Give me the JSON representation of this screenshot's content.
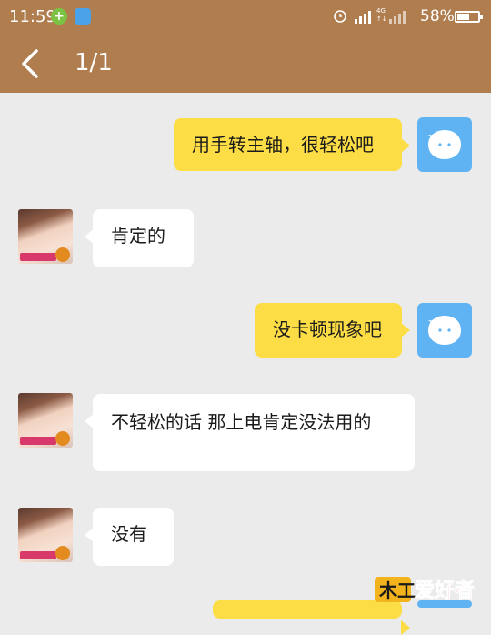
{
  "status_bar": {
    "time": "11:59",
    "network_type_top": "4G",
    "network_type_bottom": "2G",
    "battery_percent": "58%",
    "battery_level": 0.58
  },
  "header": {
    "page_counter": "1/1",
    "accent_color": "#b07d4f"
  },
  "messages": [
    {
      "sender": "me",
      "text": "用手转主轴，很轻松吧"
    },
    {
      "sender": "them",
      "text": "肯定的"
    },
    {
      "sender": "me",
      "text": "没卡顿现象吧"
    },
    {
      "sender": "them",
      "text": "不轻松的话 那上电肯定没法用的"
    },
    {
      "sender": "them",
      "text": "没有"
    }
  ],
  "watermark": {
    "logo_text": "爱好者"
  },
  "colors": {
    "my_bubble": "#fddd45",
    "their_bubble": "#ffffff",
    "background": "#ebebeb",
    "my_avatar": "#5fb3f3"
  }
}
